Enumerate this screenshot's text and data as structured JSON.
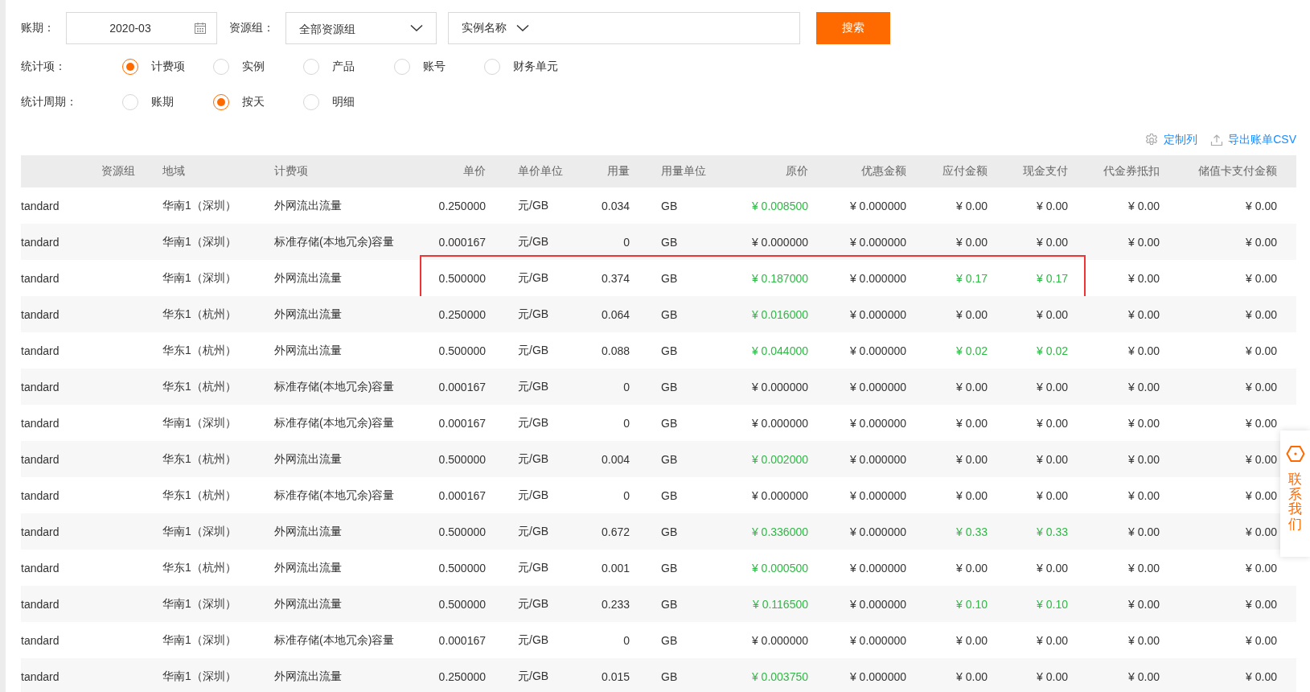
{
  "filters": {
    "period_label": "账期：",
    "period_value": "2020-03",
    "group_label": "资源组：",
    "group_value": "全部资源组",
    "instance_value": "实例名称",
    "search_button": "搜索"
  },
  "stat_items": {
    "label": "统计项：",
    "options": [
      {
        "label": "计费项",
        "selected": true
      },
      {
        "label": "实例",
        "selected": false
      },
      {
        "label": "产品",
        "selected": false
      },
      {
        "label": "账号",
        "selected": false
      },
      {
        "label": "财务单元",
        "selected": false
      }
    ]
  },
  "stat_period": {
    "label": "统计周期：",
    "options": [
      {
        "label": "账期",
        "selected": false
      },
      {
        "label": "按天",
        "selected": true
      },
      {
        "label": "明细",
        "selected": false
      }
    ]
  },
  "actions": {
    "customize": "定制列",
    "export": "导出账单CSV"
  },
  "table": {
    "columns": [
      "资源组",
      "地域",
      "计费项",
      "单价",
      "单价单位",
      "用量",
      "用量单位",
      "原价",
      "优惠金额",
      "应付金额",
      "现金支付",
      "代金券抵扣",
      "储值卡支付金额"
    ],
    "rows": [
      {
        "column_1": "tandard",
        "region": "华南1（深圳）",
        "item": "外网流出流量",
        "unit_price": "0.250000",
        "price_unit": "元/GB",
        "usage": "0.034",
        "usage_unit": "GB",
        "original_price": "¥ 0.008500",
        "discount": "¥ 0.000000",
        "payable": "¥ 0.00",
        "cash": "¥ 0.00",
        "voucher": "¥ 0.00",
        "stored_value": "¥ 0.00",
        "price_highlight": true,
        "payment_highlight": false,
        "boxed": false
      },
      {
        "column_1": "tandard",
        "region": "华南1（深圳）",
        "item": "标准存储(本地冗余)容量",
        "unit_price": "0.000167",
        "price_unit": "元/GB",
        "usage": "0",
        "usage_unit": "GB",
        "original_price": "¥ 0.000000",
        "discount": "¥ 0.000000",
        "payable": "¥ 0.00",
        "cash": "¥ 0.00",
        "voucher": "¥ 0.00",
        "stored_value": "¥ 0.00",
        "price_highlight": false,
        "payment_highlight": false,
        "boxed": false
      },
      {
        "column_1": "tandard",
        "region": "华南1（深圳）",
        "item": "外网流出流量",
        "unit_price": "0.500000",
        "price_unit": "元/GB",
        "usage": "0.374",
        "usage_unit": "GB",
        "original_price": "¥ 0.187000",
        "discount": "¥ 0.000000",
        "payable": "¥ 0.17",
        "cash": "¥ 0.17",
        "voucher": "¥ 0.00",
        "stored_value": "¥ 0.00",
        "price_highlight": true,
        "payment_highlight": true,
        "boxed": true
      },
      {
        "column_1": "tandard",
        "region": "华东1（杭州）",
        "item": "外网流出流量",
        "unit_price": "0.250000",
        "price_unit": "元/GB",
        "usage": "0.064",
        "usage_unit": "GB",
        "original_price": "¥ 0.016000",
        "discount": "¥ 0.000000",
        "payable": "¥ 0.00",
        "cash": "¥ 0.00",
        "voucher": "¥ 0.00",
        "stored_value": "¥ 0.00",
        "price_highlight": true,
        "payment_highlight": false,
        "boxed": false
      },
      {
        "column_1": "tandard",
        "region": "华东1（杭州）",
        "item": "外网流出流量",
        "unit_price": "0.500000",
        "price_unit": "元/GB",
        "usage": "0.088",
        "usage_unit": "GB",
        "original_price": "¥ 0.044000",
        "discount": "¥ 0.000000",
        "payable": "¥ 0.02",
        "cash": "¥ 0.02",
        "voucher": "¥ 0.00",
        "stored_value": "¥ 0.00",
        "price_highlight": true,
        "payment_highlight": true,
        "boxed": false
      },
      {
        "column_1": "tandard",
        "region": "华东1（杭州）",
        "item": "标准存储(本地冗余)容量",
        "unit_price": "0.000167",
        "price_unit": "元/GB",
        "usage": "0",
        "usage_unit": "GB",
        "original_price": "¥ 0.000000",
        "discount": "¥ 0.000000",
        "payable": "¥ 0.00",
        "cash": "¥ 0.00",
        "voucher": "¥ 0.00",
        "stored_value": "¥ 0.00",
        "price_highlight": false,
        "payment_highlight": false,
        "boxed": false
      },
      {
        "column_1": "tandard",
        "region": "华南1（深圳）",
        "item": "标准存储(本地冗余)容量",
        "unit_price": "0.000167",
        "price_unit": "元/GB",
        "usage": "0",
        "usage_unit": "GB",
        "original_price": "¥ 0.000000",
        "discount": "¥ 0.000000",
        "payable": "¥ 0.00",
        "cash": "¥ 0.00",
        "voucher": "¥ 0.00",
        "stored_value": "¥ 0.00",
        "price_highlight": false,
        "payment_highlight": false,
        "boxed": false
      },
      {
        "column_1": "tandard",
        "region": "华东1（杭州）",
        "item": "外网流出流量",
        "unit_price": "0.500000",
        "price_unit": "元/GB",
        "usage": "0.004",
        "usage_unit": "GB",
        "original_price": "¥ 0.002000",
        "discount": "¥ 0.000000",
        "payable": "¥ 0.00",
        "cash": "¥ 0.00",
        "voucher": "¥ 0.00",
        "stored_value": "¥ 0.00",
        "price_highlight": true,
        "payment_highlight": false,
        "boxed": false
      },
      {
        "column_1": "tandard",
        "region": "华东1（杭州）",
        "item": "标准存储(本地冗余)容量",
        "unit_price": "0.000167",
        "price_unit": "元/GB",
        "usage": "0",
        "usage_unit": "GB",
        "original_price": "¥ 0.000000",
        "discount": "¥ 0.000000",
        "payable": "¥ 0.00",
        "cash": "¥ 0.00",
        "voucher": "¥ 0.00",
        "stored_value": "¥ 0.00",
        "price_highlight": false,
        "payment_highlight": false,
        "boxed": false
      },
      {
        "column_1": "tandard",
        "region": "华南1（深圳）",
        "item": "外网流出流量",
        "unit_price": "0.500000",
        "price_unit": "元/GB",
        "usage": "0.672",
        "usage_unit": "GB",
        "original_price": "¥ 0.336000",
        "discount": "¥ 0.000000",
        "payable": "¥ 0.33",
        "cash": "¥ 0.33",
        "voucher": "¥ 0.00",
        "stored_value": "¥ 0.00",
        "price_highlight": true,
        "payment_highlight": true,
        "boxed": false
      },
      {
        "column_1": "tandard",
        "region": "华东1（杭州）",
        "item": "外网流出流量",
        "unit_price": "0.500000",
        "price_unit": "元/GB",
        "usage": "0.001",
        "usage_unit": "GB",
        "original_price": "¥ 0.000500",
        "discount": "¥ 0.000000",
        "payable": "¥ 0.00",
        "cash": "¥ 0.00",
        "voucher": "¥ 0.00",
        "stored_value": "¥ 0.00",
        "price_highlight": true,
        "payment_highlight": false,
        "boxed": false
      },
      {
        "column_1": "tandard",
        "region": "华南1（深圳）",
        "item": "外网流出流量",
        "unit_price": "0.500000",
        "price_unit": "元/GB",
        "usage": "0.233",
        "usage_unit": "GB",
        "original_price": "¥ 0.116500",
        "discount": "¥ 0.000000",
        "payable": "¥ 0.10",
        "cash": "¥ 0.10",
        "voucher": "¥ 0.00",
        "stored_value": "¥ 0.00",
        "price_highlight": true,
        "payment_highlight": true,
        "boxed": false
      },
      {
        "column_1": "tandard",
        "region": "华南1（深圳）",
        "item": "标准存储(本地冗余)容量",
        "unit_price": "0.000167",
        "price_unit": "元/GB",
        "usage": "0",
        "usage_unit": "GB",
        "original_price": "¥ 0.000000",
        "discount": "¥ 0.000000",
        "payable": "¥ 0.00",
        "cash": "¥ 0.00",
        "voucher": "¥ 0.00",
        "stored_value": "¥ 0.00",
        "price_highlight": false,
        "payment_highlight": false,
        "boxed": false
      },
      {
        "column_1": "tandard",
        "region": "华南1（深圳）",
        "item": "外网流出流量",
        "unit_price": "0.250000",
        "price_unit": "元/GB",
        "usage": "0.015",
        "usage_unit": "GB",
        "original_price": "¥ 0.003750",
        "discount": "¥ 0.000000",
        "payable": "¥ 0.00",
        "cash": "¥ 0.00",
        "voucher": "¥ 0.00",
        "stored_value": "¥ 0.00",
        "price_highlight": true,
        "payment_highlight": false,
        "boxed": false
      }
    ]
  },
  "contact_widget": {
    "label": "联系我们"
  }
}
